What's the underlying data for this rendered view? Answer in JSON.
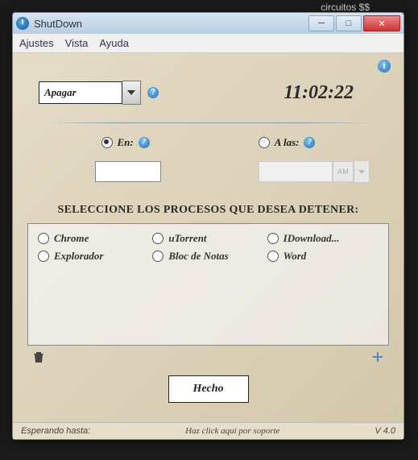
{
  "bg_text": "circuitos $$",
  "window": {
    "title": "ShutDown",
    "ampm": "AM"
  },
  "menu": {
    "settings": "Ajustes",
    "view": "Vista",
    "help": "Ayuda"
  },
  "action": {
    "selected": "Apagar"
  },
  "clock": "11:02:22",
  "mode": {
    "in_label": "En:",
    "at_label": "A las:"
  },
  "section_title": "SELECCIONE LOS PROCESOS QUE DESEA DETENER:",
  "processes": [
    "Chrome",
    "uTorrent",
    "IDownload...",
    "Explorador",
    "Bloc de Notas",
    "Word"
  ],
  "done": "Hecho",
  "status": {
    "left": "Esperando hasta:",
    "center": "Haz click aquí por soporte",
    "right": "V 4.0"
  }
}
